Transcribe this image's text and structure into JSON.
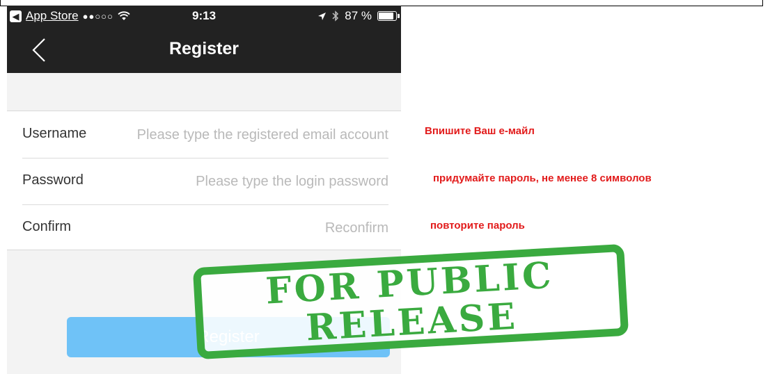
{
  "status_bar": {
    "back_app": "App Store",
    "signal": "●●○○○",
    "time": "9:13",
    "battery": "87 %"
  },
  "nav": {
    "title": "Register"
  },
  "form": {
    "username": {
      "label": "Username",
      "placeholder": "Please type the registered email account"
    },
    "password": {
      "label": "Password",
      "placeholder": "Please type the login password"
    },
    "confirm": {
      "label": "Confirm",
      "placeholder": "Reconfirm"
    }
  },
  "register_button": "Register",
  "annotations": {
    "email": "Впишите Ваш е-майл",
    "password": "придумайте пароль, не менее 8 символов",
    "confirm": "повторите пароль"
  },
  "stamp": {
    "line1": "FOR PUBLIC",
    "line2": "RELEASE"
  },
  "colors": {
    "header_bg": "#222222",
    "button_bg": "#6fc2f7",
    "annotation": "#e21b1b",
    "stamp": "#3aaa3f"
  }
}
